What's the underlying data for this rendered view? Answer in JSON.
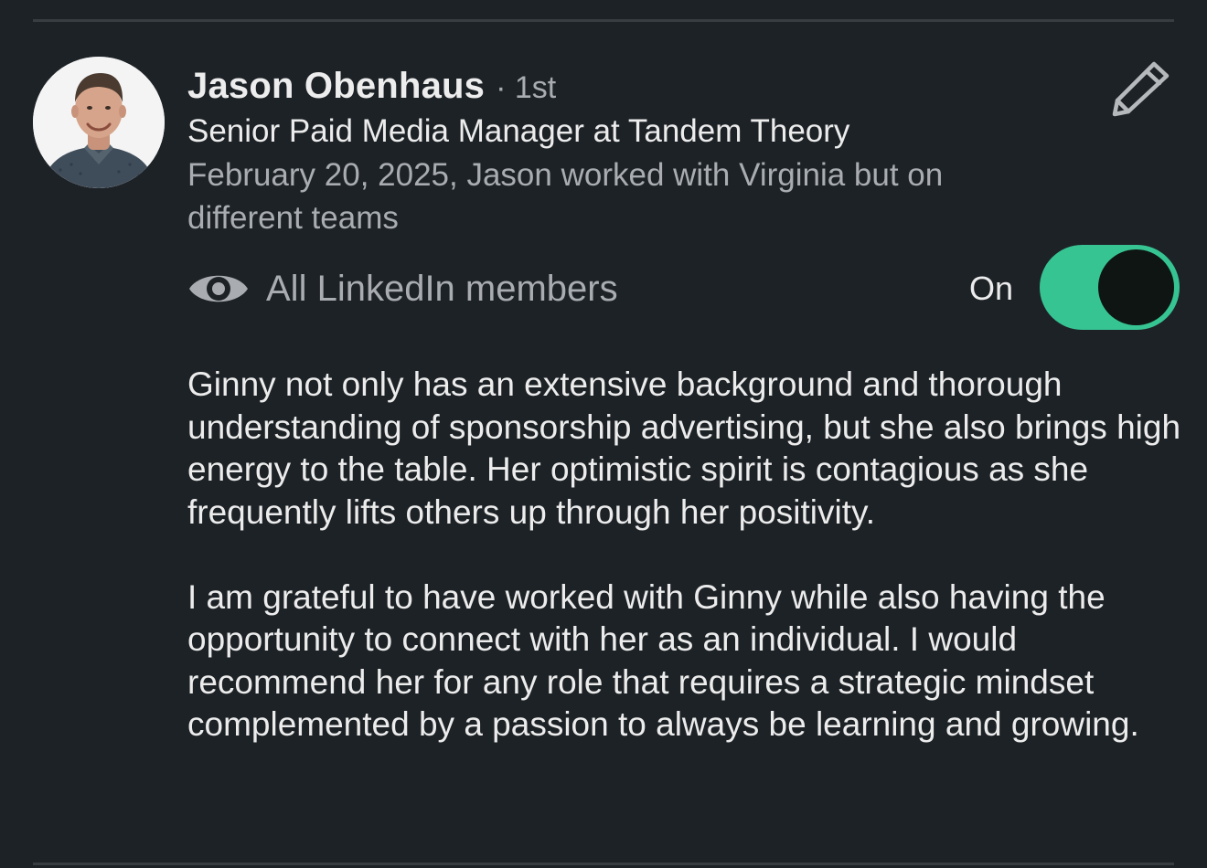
{
  "recommender": {
    "name": "Jason Obenhaus",
    "degree": "· 1st",
    "headline": "Senior Paid Media Manager at Tandem Theory",
    "meta": "February 20, 2025, Jason worked with Virginia but on different teams"
  },
  "icons": {
    "avatar": "profile-photo",
    "edit": "pencil-icon",
    "visibility": "eye-icon"
  },
  "visibility": {
    "label": "All LinkedIn members",
    "toggle_label": "On",
    "toggle_on": true
  },
  "recommendation": {
    "paragraphs": [
      "Ginny not only has an extensive background and thorough understanding of sponsorship advertising, but she also brings high energy to the table. Her optimistic spirit is contagious as she frequently lifts others up through her positivity.",
      "I am grateful to have worked with Ginny while also having the opportunity to connect with her as an individual. I would recommend her for any role that requires a strategic mindset complemented by a passion to always be learning and growing."
    ]
  },
  "colors": {
    "background": "#1d2226",
    "toggle_track": "#37c493",
    "toggle_knob": "#0e1512",
    "secondary_text": "#a9adb1"
  }
}
